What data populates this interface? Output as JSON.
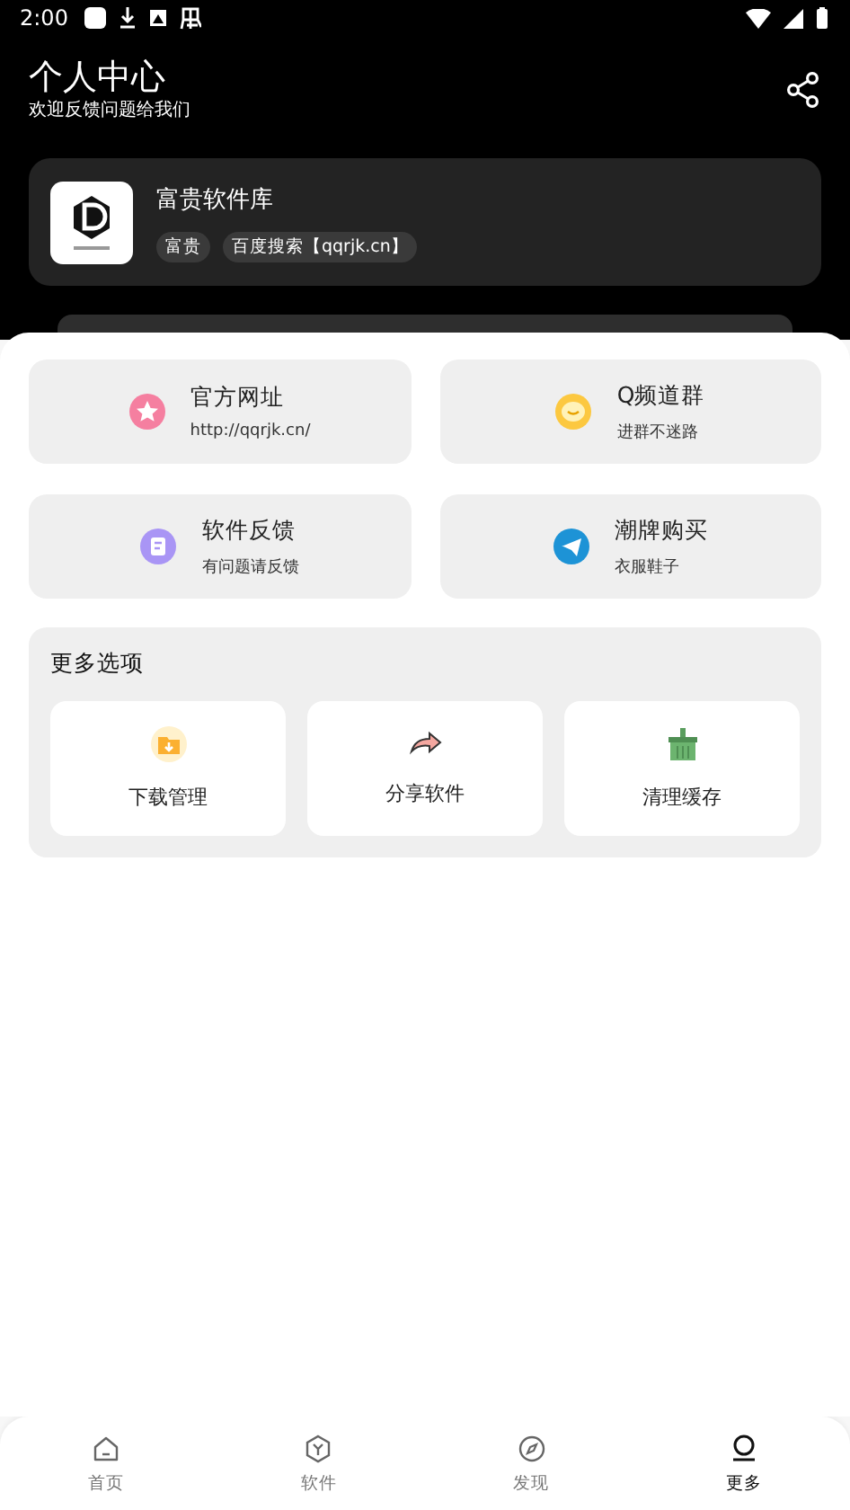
{
  "status_bar": {
    "time": "2:00"
  },
  "header": {
    "title": "个人中心",
    "subtitle": "欢迎反馈问题给我们"
  },
  "profile": {
    "name": "富贵软件库",
    "tags": [
      "富贵",
      "百度搜索【qqrjk.cn】"
    ]
  },
  "links": [
    {
      "kind": "star",
      "title": "官方网址",
      "subtitle": "http://qqrjk.cn/"
    },
    {
      "kind": "chat",
      "title": "Q频道群",
      "subtitle": "进群不迷路"
    },
    {
      "kind": "note",
      "title": "软件反馈",
      "subtitle": "有问题请反馈"
    },
    {
      "kind": "plane",
      "title": "潮牌购买",
      "subtitle": "衣服鞋子"
    }
  ],
  "more": {
    "title": "更多选项",
    "items": [
      {
        "kind": "folder",
        "label": "下载管理"
      },
      {
        "kind": "share",
        "label": "分享软件"
      },
      {
        "kind": "broom",
        "label": "清理缓存"
      }
    ]
  },
  "nav": [
    {
      "kind": "home",
      "label": "首页",
      "selected": false
    },
    {
      "kind": "cube",
      "label": "软件",
      "selected": false
    },
    {
      "kind": "compass",
      "label": "发现",
      "selected": false
    },
    {
      "kind": "person",
      "label": "更多",
      "selected": true
    }
  ]
}
